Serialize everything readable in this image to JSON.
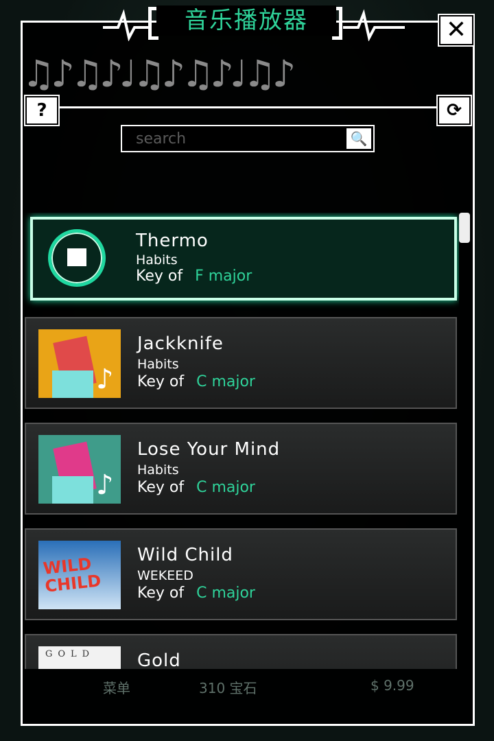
{
  "background": {
    "menu_label": "菜单",
    "gems_label": "310 宝石",
    "price": "$ 9.99"
  },
  "dialog": {
    "title": "音乐播放器",
    "close_icon": "close-icon",
    "notes_decoration": "♫♪♫♪♩♫♪♫♪♩♫♪",
    "help_label": "?",
    "refresh_icon": "refresh-icon",
    "refresh_glyph": "⟳",
    "search": {
      "placeholder": "search",
      "value": "",
      "icon": "🔍"
    }
  },
  "songs": [
    {
      "name": "Thermo",
      "artist": "Habits",
      "key_prefix": "Key of",
      "key": "F major",
      "selected": true,
      "status": "playing"
    },
    {
      "name": "Jackknife",
      "artist": "Habits",
      "key_prefix": "Key of",
      "key": "C major"
    },
    {
      "name": "Lose Your Mind",
      "artist": "Habits",
      "key_prefix": "Key of",
      "key": "C major"
    },
    {
      "name": "Wild Child",
      "artist": "WEKEED",
      "key_prefix": "Key of",
      "key": "C major",
      "art_text": "WILD CHILD"
    },
    {
      "name": "Gold",
      "artist": "",
      "key_prefix": "",
      "key": "",
      "art_text": "GOLD"
    }
  ],
  "colors": {
    "accent": "#2fd39a",
    "selected_bg": "#06261c"
  }
}
